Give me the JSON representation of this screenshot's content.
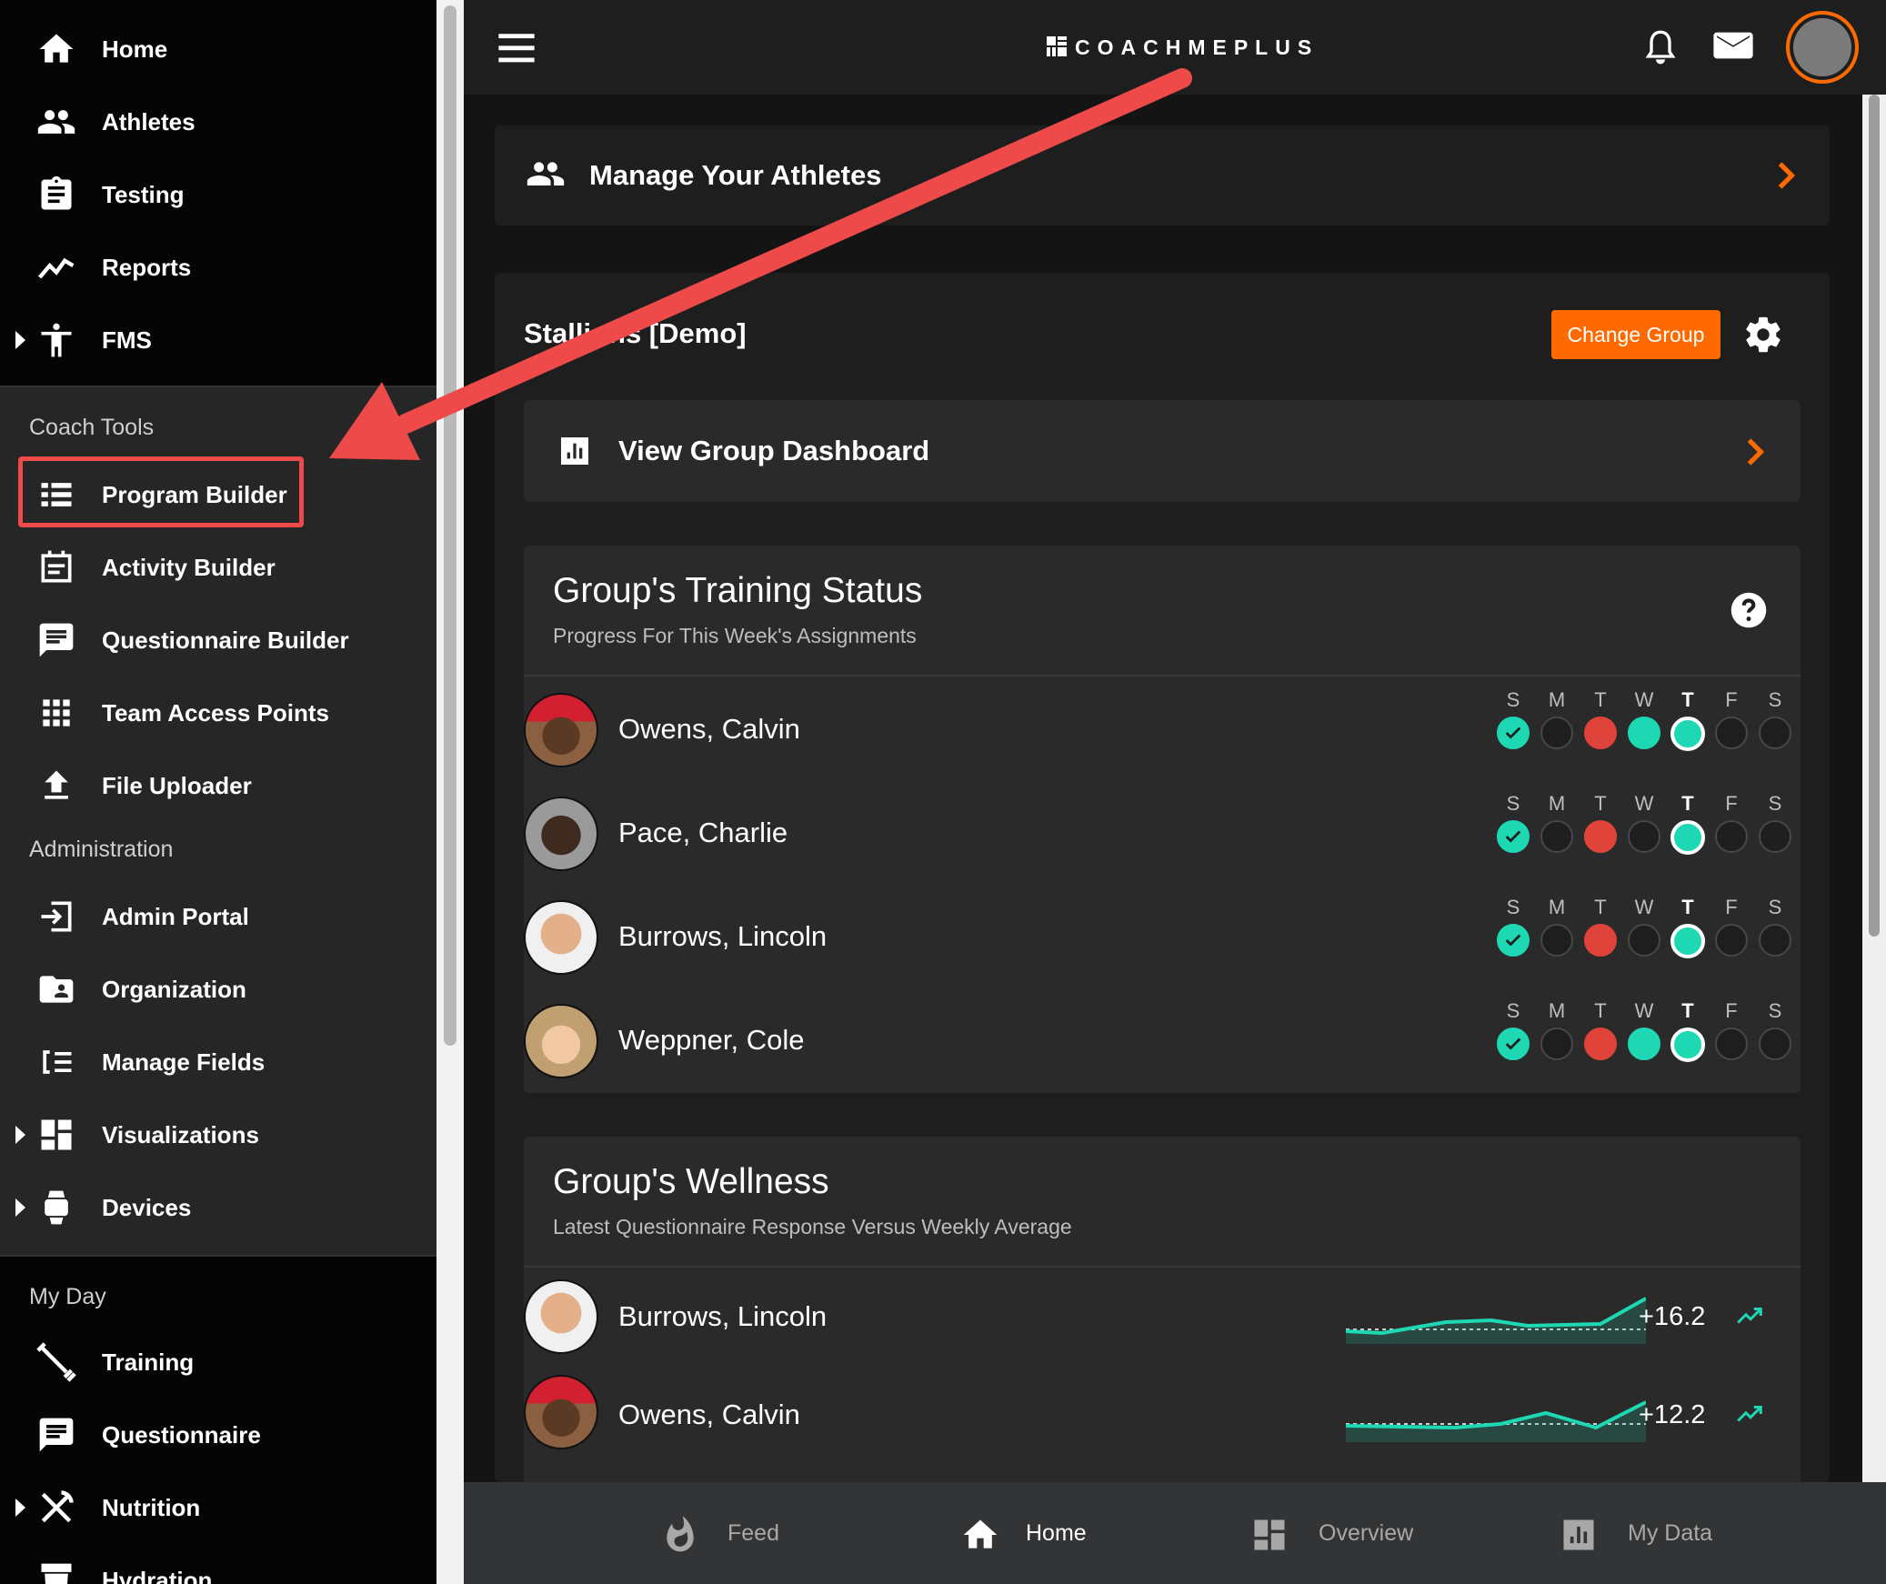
{
  "sidebar": {
    "main_items": [
      {
        "label": "Home",
        "icon": "home-icon"
      },
      {
        "label": "Athletes",
        "icon": "people-icon"
      },
      {
        "label": "Testing",
        "icon": "clipboard-icon"
      },
      {
        "label": "Reports",
        "icon": "trending-icon"
      },
      {
        "label": "FMS",
        "icon": "person-icon"
      }
    ],
    "coach_tools_header": "Coach Tools",
    "coach_tools": [
      {
        "label": "Program Builder",
        "icon": "list-icon"
      },
      {
        "label": "Activity Builder",
        "icon": "calendar-icon"
      },
      {
        "label": "Questionnaire Builder",
        "icon": "message-icon"
      },
      {
        "label": "Team Access Points",
        "icon": "grid-icon"
      },
      {
        "label": "File Uploader",
        "icon": "upload-icon"
      }
    ],
    "admin_header": "Administration",
    "admin_items": [
      {
        "label": "Admin Portal",
        "icon": "login-icon"
      },
      {
        "label": "Organization",
        "icon": "folder-user-icon"
      },
      {
        "label": "Manage Fields",
        "icon": "fields-icon"
      },
      {
        "label": "Visualizations",
        "icon": "dashboard-icon"
      },
      {
        "label": "Devices",
        "icon": "watch-icon"
      }
    ],
    "my_day_header": "My Day",
    "my_day_items": [
      {
        "label": "Training",
        "icon": "dumbbell-icon"
      },
      {
        "label": "Questionnaire",
        "icon": "message-icon"
      },
      {
        "label": "Nutrition",
        "icon": "utensils-icon"
      },
      {
        "label": "Hydration",
        "icon": "hydration-icon"
      }
    ]
  },
  "header": {
    "logo_text": "COACHMEPLUS"
  },
  "manage_card": {
    "label": "Manage Your Athletes"
  },
  "group": {
    "name": "Stallions [Demo]",
    "change_group_label": "Change Group",
    "dashboard_label": "View Group Dashboard"
  },
  "training_status": {
    "title": "Group's Training Status",
    "subtitle": "Progress For This Week's Assignments",
    "days": [
      "S",
      "M",
      "T",
      "W",
      "T",
      "F",
      "S"
    ],
    "today_index": 4,
    "athletes": [
      {
        "name": "Owens, Calvin",
        "status": [
          "check",
          "empty",
          "red",
          "teal",
          "today",
          "empty",
          "empty"
        ]
      },
      {
        "name": "Pace, Charlie",
        "status": [
          "check",
          "empty",
          "red",
          "empty",
          "today",
          "empty",
          "empty"
        ]
      },
      {
        "name": "Burrows, Lincoln",
        "status": [
          "check",
          "empty",
          "red",
          "empty",
          "today",
          "empty",
          "empty"
        ]
      },
      {
        "name": "Weppner, Cole",
        "status": [
          "check",
          "empty",
          "red",
          "teal",
          "today",
          "empty",
          "empty"
        ]
      }
    ]
  },
  "wellness": {
    "title": "Group's Wellness",
    "subtitle": "Latest Questionnaire Response Versus Weekly Average",
    "athletes": [
      {
        "name": "Burrows, Lincoln",
        "value": "+16.2"
      },
      {
        "name": "Owens, Calvin",
        "value": "+12.2"
      }
    ]
  },
  "bottom_nav": [
    {
      "label": "Feed",
      "icon": "flame-icon"
    },
    {
      "label": "Home",
      "icon": "home-icon",
      "active": true
    },
    {
      "label": "Overview",
      "icon": "dashboard-icon"
    },
    {
      "label": "My Data",
      "icon": "bar-chart-icon"
    }
  ],
  "colors": {
    "accent_orange": "#ff6a00",
    "highlight_red": "#ee4a4a",
    "status_teal": "#1ed8b4",
    "status_red": "#e0433a"
  }
}
